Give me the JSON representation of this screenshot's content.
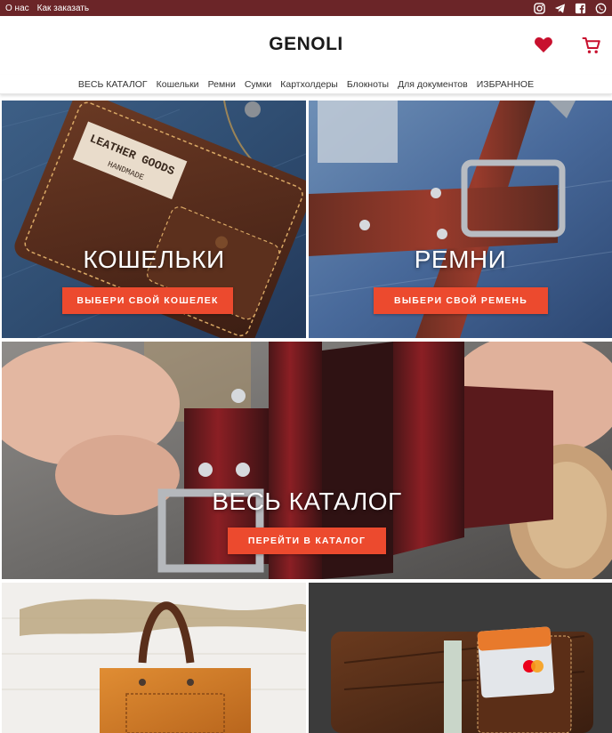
{
  "topbar": {
    "links": [
      "О нас",
      "Как заказать"
    ],
    "social_icons": [
      "instagram-icon",
      "telegram-icon",
      "facebook-icon",
      "whatsapp-icon"
    ],
    "background": "#6b2528"
  },
  "header": {
    "logo": "GENOLI",
    "favorites_icon": "heart-icon",
    "cart_icon": "cart-icon",
    "accent_color": "#c8102e"
  },
  "nav": {
    "items": [
      "ВЕСЬ КАТАЛОГ",
      "Кошельки",
      "Ремни",
      "Сумки",
      "Картхолдеры",
      "Блокноты",
      "Для документов",
      "ИЗБРАННОЕ"
    ]
  },
  "tiles": {
    "wallets": {
      "title": "КОШЕЛЬКИ",
      "button": "ВЫБЕРИ СВОЙ КОШЕЛЕК",
      "stamp_line1": "LEATHER GOODS",
      "stamp_line2": "HANDMADE"
    },
    "belts": {
      "title": "РЕМНИ",
      "button": "ВЫБЕРИ СВОЙ РЕМЕНЬ"
    },
    "catalog": {
      "title": "ВЕСЬ КАТАЛОГ",
      "button": "ПЕРЕЙТИ В КАТАЛОГ"
    },
    "bags": {
      "title": "",
      "button": ""
    },
    "cardholders": {
      "title": "",
      "button": ""
    }
  },
  "colors": {
    "button": "#ec4a2e",
    "topbar": "#6b2528"
  }
}
